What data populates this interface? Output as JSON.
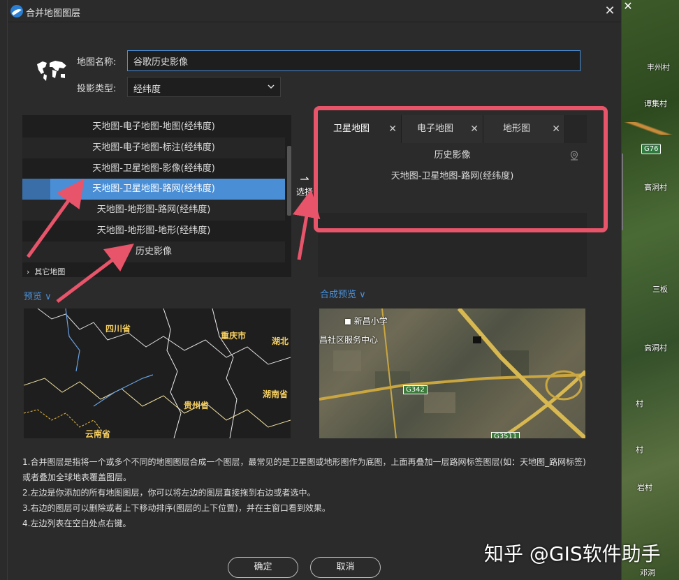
{
  "window": {
    "title": "合并地图图层",
    "close_glyph": "✕"
  },
  "background_map": {
    "close_glyph": "✕",
    "labels": [
      "丰州村",
      "谭集村",
      "高洞村",
      "三板",
      "高洞村",
      "村",
      "村",
      "岩村",
      "邓洞"
    ],
    "road_badge": "G76"
  },
  "form": {
    "name_label": "地图名称:",
    "name_value": "谷歌历史影像",
    "proj_label": "投影类型:",
    "proj_value": "经纬度"
  },
  "left_list": {
    "items": [
      "天地图-电子地图-地图(经纬度)",
      "天地图-电子地图-标注(经纬度)",
      "天地图-卫星地图-影像(经纬度)",
      "天地图-卫星地图-路网(经纬度)",
      "天地图-地形图-路网(经纬度)",
      "天地图-地形图-地形(经纬度)",
      "历史影像"
    ],
    "group": "其它地图"
  },
  "select_button": {
    "arrow": "⇀",
    "label": "选择"
  },
  "right_panel": {
    "tabs": [
      {
        "label": "卫星地图",
        "close": "✕"
      },
      {
        "label": "电子地图",
        "close": "✕"
      },
      {
        "label": "地形图",
        "close": "✕"
      }
    ],
    "layers": [
      "历史影像",
      "天地图-卫星地图-路网(经纬度)"
    ]
  },
  "preview": {
    "label": "预览",
    "chevron": "∨",
    "provinces": [
      "四川省",
      "重庆市",
      "湖北",
      "湖南省",
      "贵州省",
      "云南省"
    ]
  },
  "compose_preview": {
    "label": "合成预览",
    "chevron": "∨",
    "texts": [
      "新昌小学",
      "昌社区服务中心"
    ],
    "badges": [
      "G342",
      "G3511"
    ]
  },
  "notes": [
    "1.合并图层是指将一个或多个不同的地图图层合成一个图层，最常见的是卫星图或地形图作为底图，上面再叠加一层路网标签图层(如：天地图_路网标签)",
    "或者叠加全球地表覆盖图层。",
    "2.左边是你添加的所有地图图层，你可以将左边的图层直接拖到右边或者选中。",
    "3.右边的图层可以删除或者上下移动排序(图层的上下位置)，并在主窗口看到效果。",
    "4.左边列表在空白处点右键。"
  ],
  "buttons": {
    "ok": "确定",
    "cancel": "取消"
  },
  "watermark": "知乎 @GIS软件助手",
  "colors": {
    "accent": "#4a90d9",
    "highlight_box": "#e8546a",
    "selected_row": "#4a8ed6"
  }
}
